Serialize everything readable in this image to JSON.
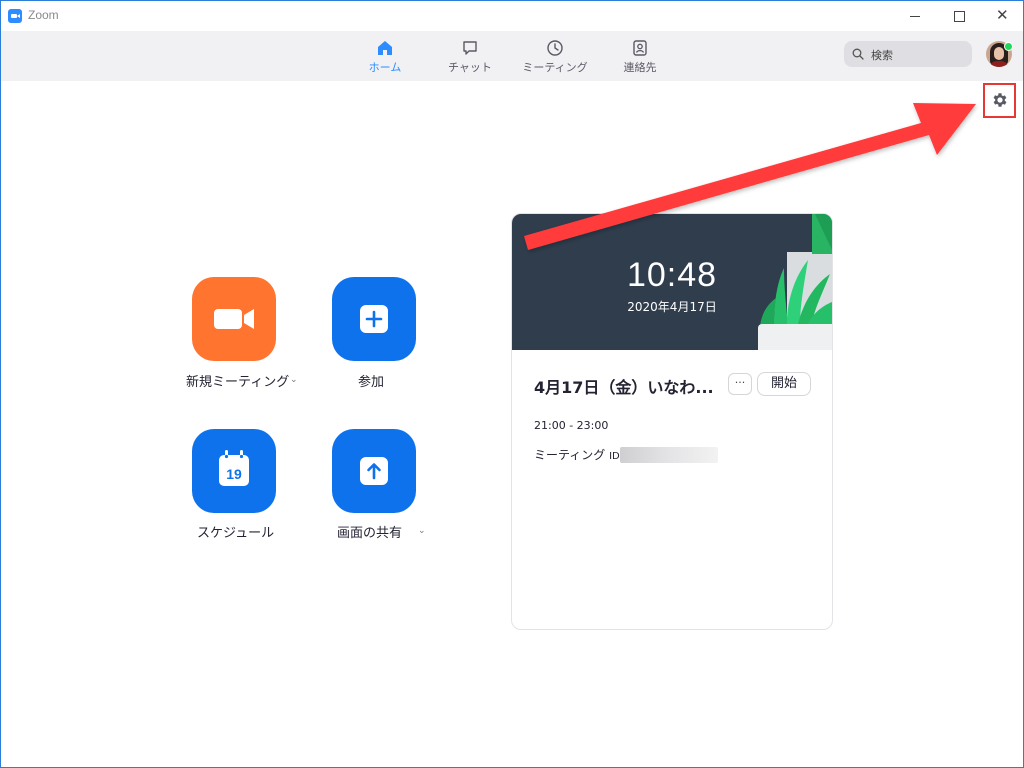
{
  "window": {
    "title": "Zoom"
  },
  "nav": {
    "items": [
      {
        "label": "ホーム",
        "icon": "home-icon",
        "active": true
      },
      {
        "label": "チャット",
        "icon": "chat-icon",
        "active": false
      },
      {
        "label": "ミーティング",
        "icon": "clock-icon",
        "active": false
      },
      {
        "label": "連絡先",
        "icon": "contacts-icon",
        "active": false
      }
    ]
  },
  "search": {
    "label": "検索",
    "icon": "search-icon"
  },
  "profile": {
    "status_color": "#23d959"
  },
  "actions": {
    "new_meeting": "新規ミーティング",
    "join": "参加",
    "schedule": "スケジュール",
    "share_screen": "画面の共有",
    "calendar_day": "19"
  },
  "card": {
    "clock": "10:48",
    "date": "2020年4月17日",
    "meeting_title": "4月17日（金）いなわ...",
    "more_label": "···",
    "start_label": "開始",
    "time_range": "21:00 - 23:00",
    "id_label": "ミーティング",
    "id_suffix": "ID:"
  },
  "colors": {
    "accent": "#2d8cff",
    "orange": "#ff742e",
    "blue_tile": "#0e72ed",
    "annotation": "#e53935"
  }
}
